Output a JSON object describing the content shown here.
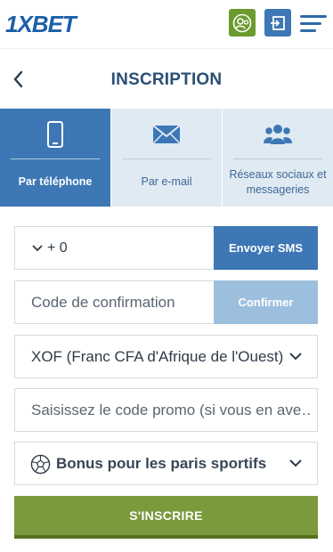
{
  "header": {
    "logo": "1XBET",
    "account_icon": "account-icon",
    "login_icon": "login-icon",
    "menu_icon": "hamburger-menu-icon"
  },
  "title": "INSCRIPTION",
  "tabs": [
    {
      "label": "Par téléphone",
      "icon": "phone-icon",
      "active": true
    },
    {
      "label": "Par e-mail",
      "icon": "envelope-icon",
      "active": false
    },
    {
      "label": "Réseaux sociaux et messageries",
      "icon": "users-icon",
      "active": false
    }
  ],
  "form": {
    "phone_prefix": "+ 0",
    "send_sms_label": "Envoyer SMS",
    "code_placeholder": "Code de confirmation",
    "confirm_label": "Confirmer",
    "currency_value": "XOF (Franc CFA d'Afrique de l'Ouest)",
    "promo_placeholder": "Saisissez le code promo (si vous en ave…",
    "bonus_value": "Bonus pour les paris sportifs"
  },
  "submit_label": "S'INSCRIRE",
  "colors": {
    "brand_blue": "#3d77b5",
    "title_blue": "#2b4f73",
    "tab_bg": "#e0eaf3",
    "green": "#7a9a3c"
  }
}
